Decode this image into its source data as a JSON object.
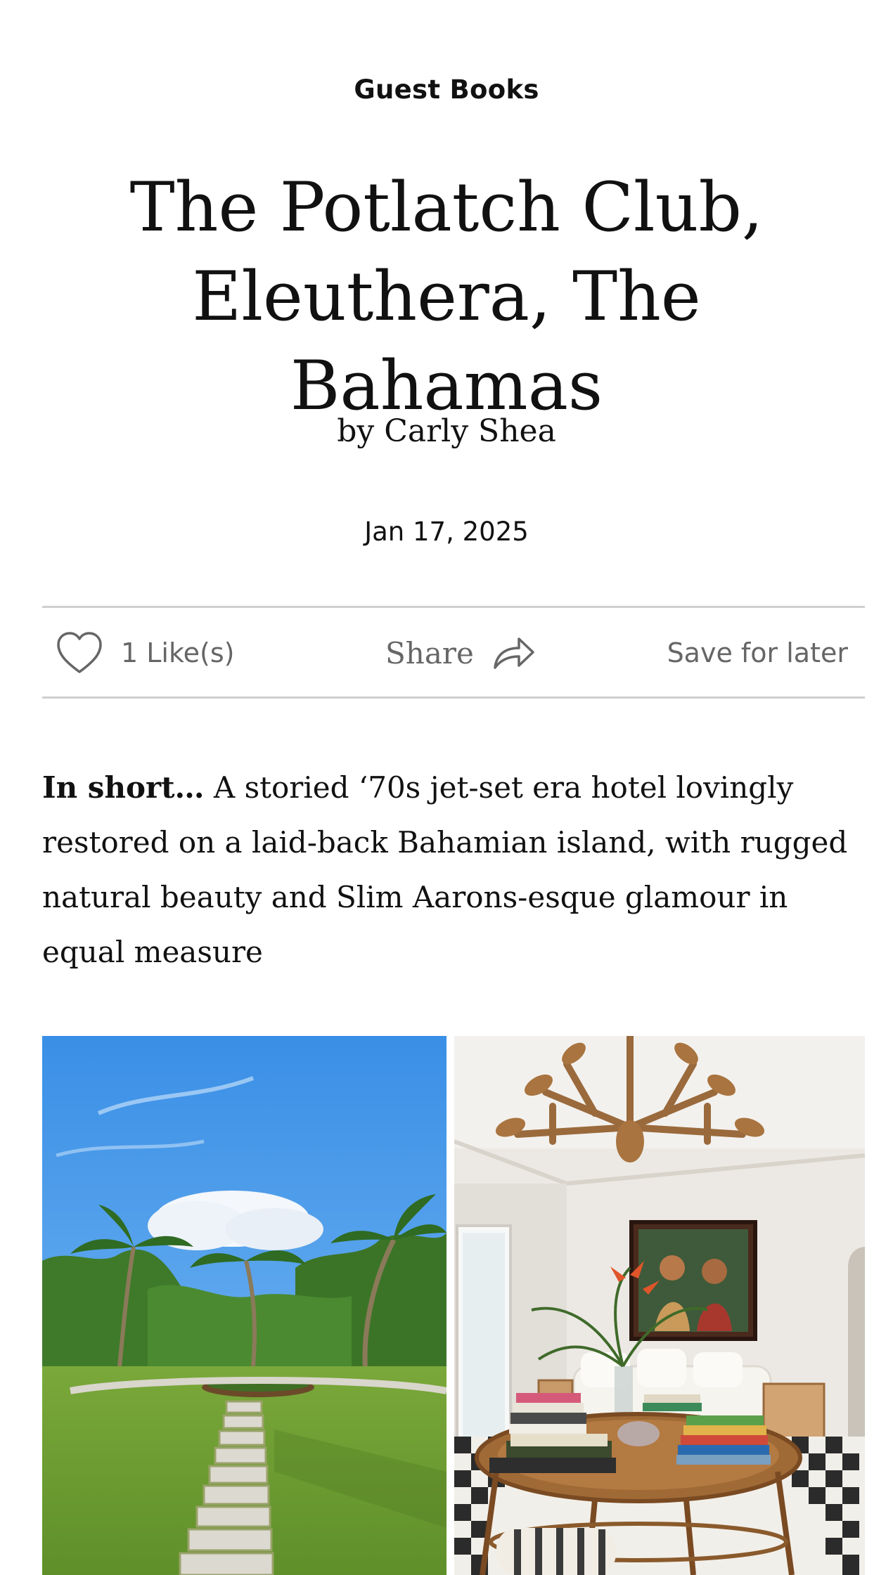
{
  "category": "Guest Books",
  "title_line1": "The Potlatch Club,",
  "title_line2": "Eleuthera, The Bahamas",
  "byline": "by Carly Shea",
  "date": "Jan 17, 2025",
  "actions": {
    "like_label": "1 Like(s)",
    "share_label": "Share",
    "save_label": "Save for later",
    "like_icon": "heart-icon",
    "share_icon": "share-arrow-icon"
  },
  "summary": {
    "lead": "In short…",
    "text": "A storied ‘70s jet-set era hotel lovingly restored on a laid-back Bahamian island, with rugged natural beauty and Slim Aarons-esque glamour in equal measure"
  },
  "colors": {
    "text": "#111111",
    "muted": "#666666",
    "divider": "#cfcfcf"
  }
}
